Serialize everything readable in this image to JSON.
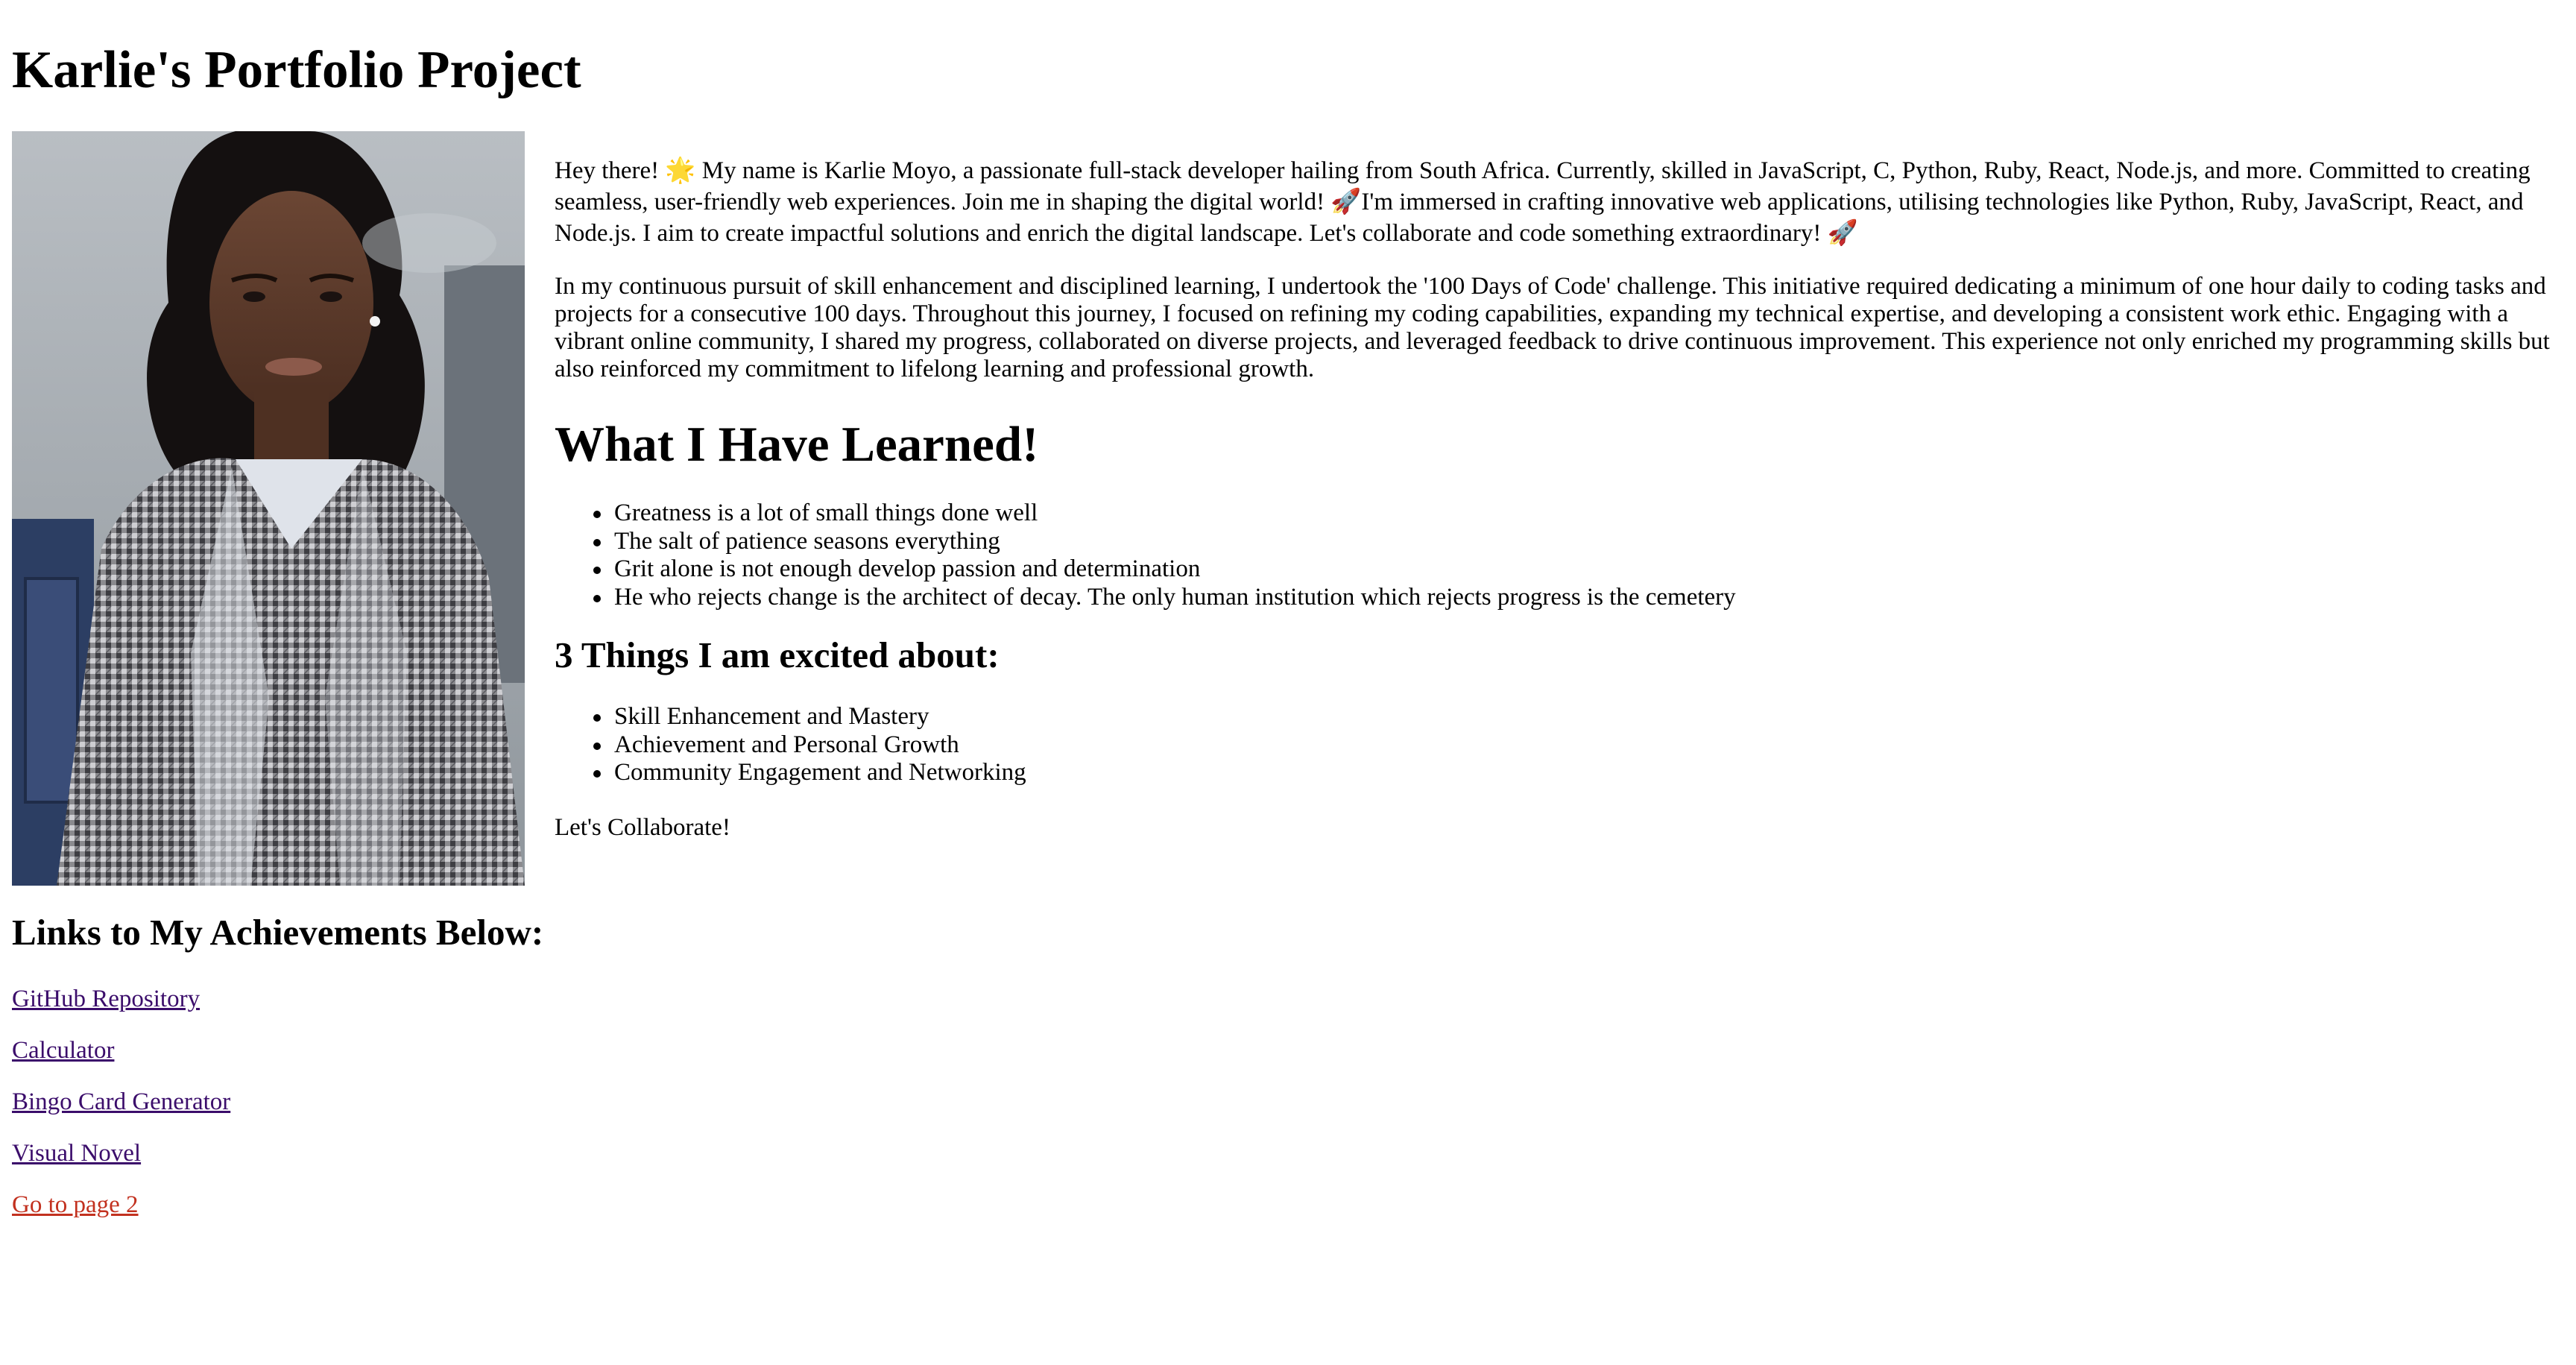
{
  "page": {
    "title": "Karlie's Portfolio Project"
  },
  "profile_photo": {
    "alt": "Profile photo of Karlie Moyo"
  },
  "about": {
    "intro": "Hey there! 🌟 My name is Karlie Moyo, a passionate full-stack developer hailing from South Africa. Currently, skilled in JavaScript, C, Python, Ruby, React, Node.js, and more. Committed to creating seamless, user-friendly web experiences. Join me in shaping the digital world! 🚀I'm immersed in crafting innovative web applications, utilising technologies like Python, Ruby, JavaScript, React, and Node.js. I aim to create impactful solutions and enrich the digital landscape. Let's collaborate and code something extraordinary! 🚀",
    "challenge": "In my continuous pursuit of skill enhancement and disciplined learning, I undertook the '100 Days of Code' challenge. This initiative required dedicating a minimum of one hour daily to coding tasks and projects for a consecutive 100 days. Throughout this journey, I focused on refining my coding capabilities, expanding my technical expertise, and developing a consistent work ethic. Engaging with a vibrant online community, I shared my progress, collaborated on diverse projects, and leveraged feedback to drive continuous improvement. This experience not only enriched my programming skills but also reinforced my commitment to lifelong learning and professional growth."
  },
  "learned": {
    "heading": "What I Have Learned!",
    "items": [
      "Greatness is a lot of small things done well",
      "The salt of patience seasons everything",
      "Grit alone is not enough develop passion and determination",
      "He who rejects change is the architect of decay. The only human institution which rejects progress is the cemetery"
    ]
  },
  "excited": {
    "heading": "3 Things I am excited about:",
    "items": [
      "Skill Enhancement and Mastery",
      "Achievement and Personal Growth",
      "Community Engagement and Networking"
    ]
  },
  "collaborate": "Let's Collaborate!",
  "achievements": {
    "heading": "Links to My Achievements Below:",
    "links": [
      "GitHub Repository",
      "Calculator",
      "Bingo Card Generator",
      "Visual Novel",
      "Go to page 2"
    ]
  },
  "colors": {
    "visited_link": "#3b0d6b",
    "page2_link": "#c2311f",
    "text": "#000000",
    "background": "#ffffff"
  }
}
